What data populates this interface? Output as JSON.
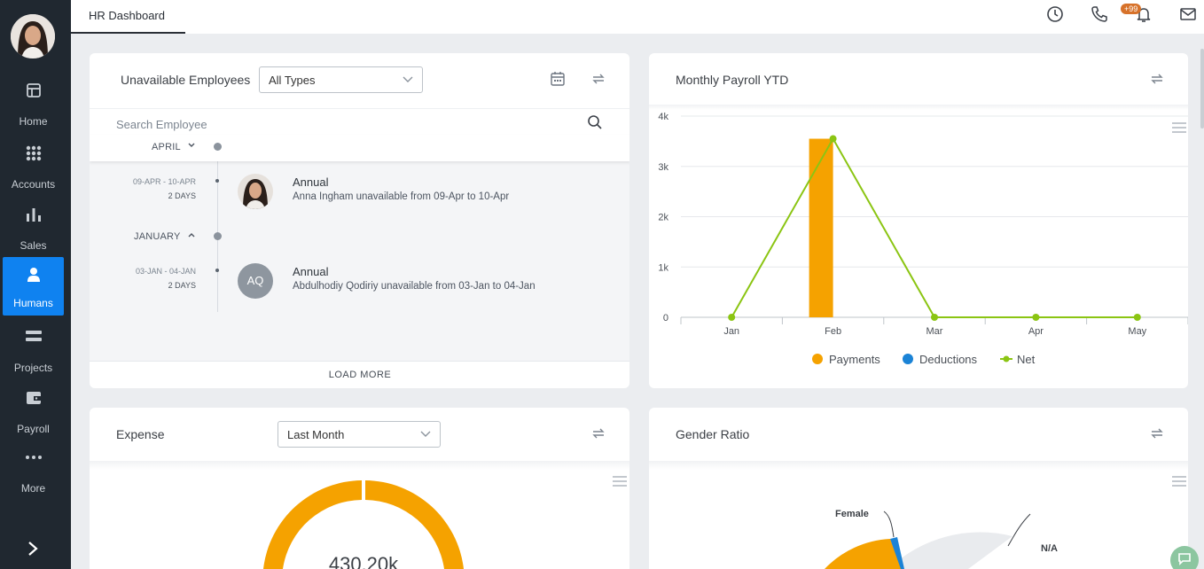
{
  "topbar": {
    "tab_label": "HR Dashboard",
    "notifications_badge": "+99"
  },
  "sidebar": {
    "items": [
      {
        "label": "Home",
        "icon": "home-icon"
      },
      {
        "label": "Accounts",
        "icon": "grid-icon"
      },
      {
        "label": "Sales",
        "icon": "bar-chart-icon"
      },
      {
        "label": "Humans",
        "icon": "person-icon",
        "active": true
      },
      {
        "label": "Projects",
        "icon": "projects-icon"
      },
      {
        "label": "Payroll",
        "icon": "wallet-icon"
      },
      {
        "label": "More",
        "icon": "more-icon"
      }
    ]
  },
  "unavailable": {
    "title": "Unavailable Employees",
    "filter_value": "All Types",
    "search_placeholder": "Search Employee",
    "groups": [
      {
        "month": "APRIL",
        "entries": [
          {
            "range": "09-APR - 10-APR",
            "days": "2 DAYS",
            "type": "Annual",
            "desc": "Anna Ingham unavailable from 09-Apr to 10-Apr"
          }
        ]
      },
      {
        "month": "JANUARY",
        "entries": [
          {
            "range": "03-JAN - 04-JAN",
            "days": "2 DAYS",
            "type": "Annual",
            "desc": "Abdulhodiy Qodiriy unavailable from 03-Jan to 04-Jan",
            "initials": "AQ"
          }
        ]
      }
    ],
    "load_more": "LOAD MORE"
  },
  "payroll": {
    "title": "Monthly Payroll YTD"
  },
  "expense": {
    "title": "Expense",
    "filter_value": "Last Month",
    "center_value": "430.20k"
  },
  "gender": {
    "title": "Gender Ratio",
    "labels": [
      "Female",
      "N/A"
    ]
  },
  "colors": {
    "payments": "#f5a200",
    "deductions": "#1b83d6",
    "net": "#8bc513",
    "active_nav": "#0f82f0"
  },
  "chart_data": [
    {
      "type": "bar",
      "categories": [
        "Jan",
        "Feb",
        "Mar",
        "Apr",
        "May"
      ],
      "series": [
        {
          "name": "Payments",
          "type": "bar",
          "values": [
            0,
            3550,
            0,
            0,
            0
          ]
        },
        {
          "name": "Deductions",
          "type": "bar",
          "values": [
            0,
            0,
            0,
            0,
            0
          ]
        },
        {
          "name": "Net",
          "type": "line",
          "values": [
            0,
            3550,
            0,
            0,
            0
          ]
        }
      ],
      "yticks": [
        "0",
        "1k",
        "2k",
        "3k",
        "4k"
      ],
      "ylim": [
        0,
        4000
      ],
      "grid": true,
      "legend": "bottom"
    },
    {
      "type": "pie",
      "center_label": "430.20k"
    },
    {
      "type": "pie",
      "labels": [
        "Female",
        "N/A"
      ]
    }
  ]
}
